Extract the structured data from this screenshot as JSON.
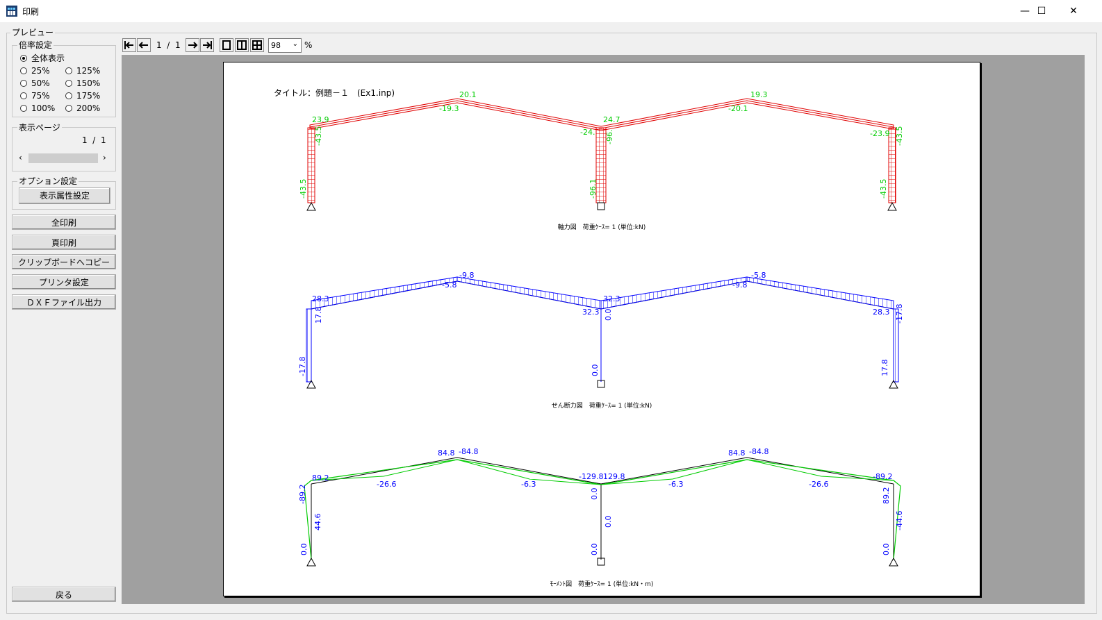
{
  "window": {
    "title": "印刷"
  },
  "preview_group": {
    "label": "プレビュー"
  },
  "zoom_group": {
    "label": "倍率設定",
    "options": [
      "全体表示",
      "25%",
      "125%",
      "50%",
      "150%",
      "75%",
      "175%",
      "100%",
      "200%"
    ],
    "selected": "全体表示"
  },
  "page_group": {
    "label": "表示ページ",
    "current": "1",
    "sep": "/",
    "total": "1"
  },
  "option_group": {
    "label": "オプション設定",
    "attr_button": "表示属性設定"
  },
  "buttons": {
    "print_all": "全印刷",
    "print_page": "頁印刷",
    "copy_clipboard": "クリップボードへコピー",
    "printer_setup": "プリンタ設定",
    "dxf_output": "ＤＸＦファイル出力",
    "back": "戻る"
  },
  "toolbar": {
    "page_current": "1",
    "page_sep": "/",
    "page_total": "1",
    "zoom_value": "98",
    "zoom_unit": "%"
  },
  "colors": {
    "axial": "#e00000",
    "shear": "#0000ff",
    "moment": "#00cc00",
    "frame": "#000000"
  },
  "document": {
    "title": "タイトル：例題－１　(Ex1.inp)",
    "diagrams": [
      {
        "caption": "軸力図　荷重ｹｰｽ= 1 (単位:kN)",
        "labels": [
          "20.1",
          "-19.3",
          "23.9",
          "-43.5",
          "-43.5",
          "-24.",
          "24.7",
          "-96.",
          "-96.1",
          "19.3",
          "-20.1",
          "-23.9",
          "-43.5",
          "-43.5"
        ]
      },
      {
        "caption": "せん断力図　荷重ｹｰｽ= 1 (単位:kN)",
        "labels": [
          "-9.8",
          "-5.8",
          "28.3",
          "17.8",
          "-17.8",
          "32.3",
          "32.3",
          "0.0",
          "0.0",
          "-5.8",
          "-9.8",
          "28.3",
          "-17.8",
          "17.8"
        ]
      },
      {
        "caption": "ﾓｰﾒﾝﾄ図　荷重ｹｰｽ= 1 (単位:kN・m)",
        "labels": [
          "84.8",
          "-84.8",
          "89.2",
          "-89.2",
          "-26.6",
          "44.6",
          "0.0",
          "-6.3",
          "-129.8",
          "129.8",
          "0.0",
          "0.0",
          "0.0",
          "-6.3",
          "84.8",
          "-84.8",
          "-26.6",
          "-89.2",
          "89.2",
          "-44.6",
          "0.0"
        ]
      }
    ]
  }
}
